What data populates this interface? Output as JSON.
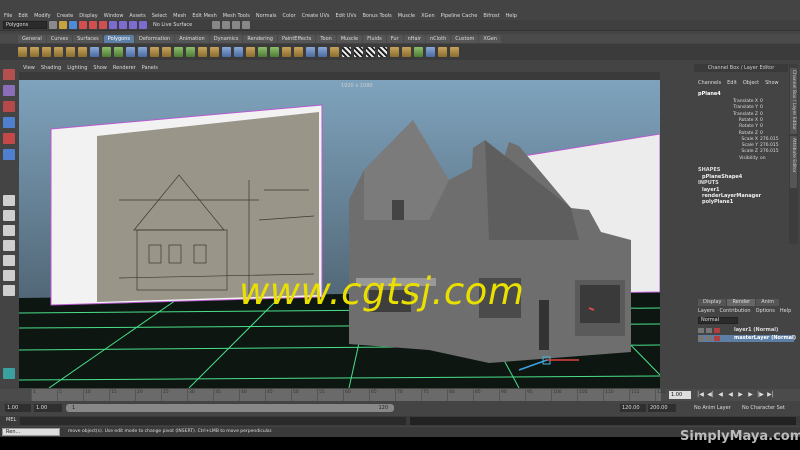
{
  "menubar": [
    "File",
    "Edit",
    "Modify",
    "Create",
    "Display",
    "Window",
    "Assets",
    "Select",
    "Mesh",
    "Edit Mesh",
    "Mesh Tools",
    "Normals",
    "Color",
    "Create UVs",
    "Edit UVs",
    "Bonus Tools",
    "Muscle",
    "XGen",
    "Pipeline Cache",
    "Bifrost",
    "Help"
  ],
  "status_line": {
    "mode": "Polygons",
    "live_surface": "No Live Surface"
  },
  "shelf_tabs": [
    "General",
    "Curves",
    "Surfaces",
    "Polygons",
    "Deformation",
    "Animation",
    "Dynamics",
    "Rendering",
    "PaintEffects",
    "Toon",
    "Muscle",
    "Fluids",
    "Fur",
    "nHair",
    "nCloth",
    "Custom",
    "XGen"
  ],
  "active_shelf_tab": "Polygons",
  "viewport": {
    "menu": [
      "View",
      "Shading",
      "Lighting",
      "Show",
      "Renderer",
      "Panels"
    ],
    "resolution": "1920 x 1080",
    "watermark": "www.cgtsj.com"
  },
  "channel_box": {
    "title": "Channel Box / Layer Editor",
    "menu": [
      "Channels",
      "Edit",
      "Object",
      "Show"
    ],
    "object": "pPlane4",
    "attributes": [
      {
        "name": "Translate X",
        "value": "0"
      },
      {
        "name": "Translate Y",
        "value": "0"
      },
      {
        "name": "Translate Z",
        "value": "0"
      },
      {
        "name": "Rotate X",
        "value": "0"
      },
      {
        "name": "Rotate Y",
        "value": "0"
      },
      {
        "name": "Rotate Z",
        "value": "0"
      },
      {
        "name": "Scale X",
        "value": "276.015"
      },
      {
        "name": "Scale Y",
        "value": "276.015"
      },
      {
        "name": "Scale Z",
        "value": "276.015"
      },
      {
        "name": "Visibility",
        "value": "on"
      }
    ],
    "shapes_label": "SHAPES",
    "shapes": [
      "pPlaneShape4"
    ],
    "inputs_label": "INPUTS",
    "inputs": [
      "layer1",
      "renderLayerManager",
      "polyPlane1"
    ]
  },
  "side_tabs": [
    "Channel Box / Layer Editor",
    "Attribute Editor"
  ],
  "layer_editor": {
    "tabs": [
      "Display",
      "Render",
      "Anim"
    ],
    "active_tab": "Render",
    "menu": [
      "Layers",
      "Contribution",
      "Options",
      "Help"
    ],
    "blend_mode": "Normal",
    "layers": [
      "layer1 (Normal)",
      "masterLayer (Normal)"
    ]
  },
  "time_slider": {
    "ticks": [
      "1",
      "5",
      "10",
      "15",
      "20",
      "25",
      "30",
      "35",
      "40",
      "45",
      "50",
      "55",
      "60",
      "65",
      "70",
      "75",
      "80",
      "85",
      "90",
      "95",
      "100",
      "105",
      "110",
      "115",
      "120"
    ],
    "current_frame": "1.00"
  },
  "range_slider": {
    "start": "1.00",
    "anim_start": "1.00",
    "range_start": "1",
    "range_end": "120",
    "range_end_field": "120.00",
    "anim_end": "200.00",
    "anim_layer": "No Anim Layer",
    "character_set": "No Character Set"
  },
  "command_line": {
    "label": "MEL"
  },
  "help_line": {
    "text": "move object(s). Use edit mode to change pivot (INSERT). Ctrl+LMB to move perpendicular.",
    "task": "Ren..."
  },
  "brand": "SimplyMaya.com"
}
